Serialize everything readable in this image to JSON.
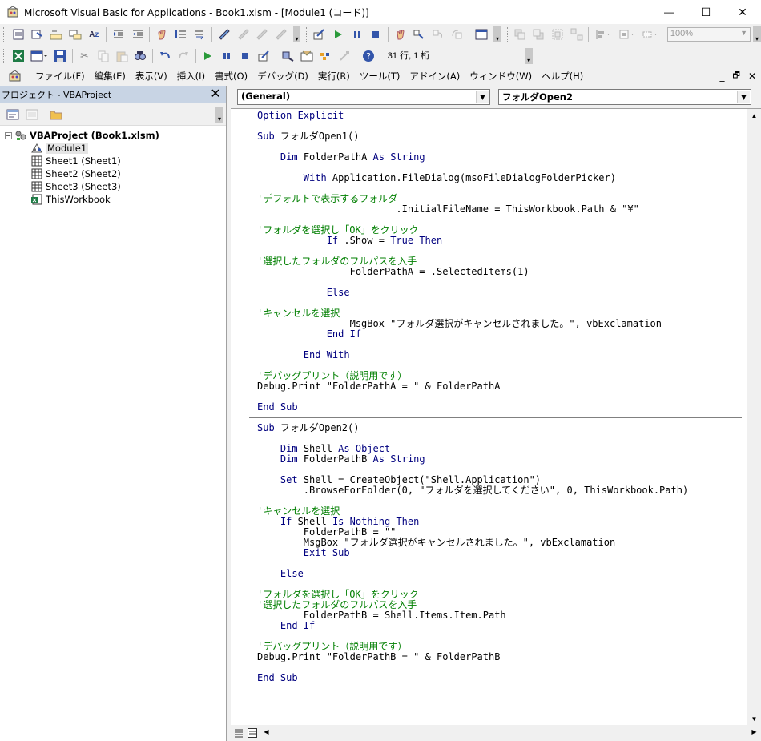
{
  "window": {
    "title": "Microsoft Visual Basic for Applications - Book1.xlsm - [Module1 (コード)]",
    "controls": {
      "minimize": "—",
      "maximize": "☐",
      "close": "✕"
    }
  },
  "toolbar": {
    "zoom": "100%",
    "cursor_position": "31 行, 1 桁"
  },
  "menu": {
    "items": [
      "ファイル(F)",
      "編集(E)",
      "表示(V)",
      "挿入(I)",
      "書式(O)",
      "デバッグ(D)",
      "実行(R)",
      "ツール(T)",
      "アドイン(A)",
      "ウィンドウ(W)",
      "ヘルプ(H)"
    ],
    "mdi_controls": {
      "minimize": "_",
      "restore": "🗗",
      "close": "✕"
    }
  },
  "project_pane": {
    "title": "プロジェクト - VBAProject",
    "close": "✕",
    "root": "VBAProject (Book1.xlsm)",
    "items": [
      "Module1",
      "Sheet1 (Sheet1)",
      "Sheet2 (Sheet2)",
      "Sheet3 (Sheet3)",
      "ThisWorkbook"
    ]
  },
  "code_window": {
    "object_combo": "(General)",
    "procedure_combo": "フォルダOpen2",
    "lines": [
      {
        "t": "Option Explicit",
        "k": "kw"
      },
      {
        "t": "",
        "k": ""
      },
      {
        "t": "Sub フォルダOpen1()",
        "k": "sub"
      },
      {
        "t": "",
        "k": ""
      },
      {
        "t": "    Dim FolderPathA As String",
        "k": "dim"
      },
      {
        "t": "",
        "k": ""
      },
      {
        "t": "        With Application.FileDialog(msoFileDialogFolderPicker)",
        "k": "with"
      },
      {
        "t": "",
        "k": ""
      },
      {
        "t": "'デフォルトで表示するフォルダ",
        "k": "cm"
      },
      {
        "t": "                        .InitialFileName = ThisWorkbook.Path & \"¥\"",
        "k": ""
      },
      {
        "t": "",
        "k": ""
      },
      {
        "t": "'フォルダを選択し「OK」をクリック",
        "k": "cm"
      },
      {
        "t": "            If .Show = True Then",
        "k": "if"
      },
      {
        "t": "",
        "k": ""
      },
      {
        "t": "'選択したフォルダのフルパスを入手",
        "k": "cm"
      },
      {
        "t": "                FolderPathA = .SelectedItems(1)",
        "k": ""
      },
      {
        "t": "",
        "k": ""
      },
      {
        "t": "            Else",
        "k": "kw"
      },
      {
        "t": "",
        "k": ""
      },
      {
        "t": "'キャンセルを選択",
        "k": "cm"
      },
      {
        "t": "                MsgBox \"フォルダ選択がキャンセルされました。\", vbExclamation",
        "k": ""
      },
      {
        "t": "            End If",
        "k": "kw"
      },
      {
        "t": "",
        "k": ""
      },
      {
        "t": "        End With",
        "k": "kw"
      },
      {
        "t": "",
        "k": ""
      },
      {
        "t": "'デバッグプリント（説明用です）",
        "k": "cm"
      },
      {
        "t": "Debug.Print \"FolderPathA = \" & FolderPathA",
        "k": "dbg"
      },
      {
        "t": "",
        "k": ""
      },
      {
        "t": "End Sub",
        "k": "kw"
      },
      {
        "t": "",
        "k": "divider"
      },
      {
        "t": "Sub フォルダOpen2()",
        "k": "sub"
      },
      {
        "t": "",
        "k": ""
      },
      {
        "t": "    Dim Shell As Object",
        "k": "dim"
      },
      {
        "t": "    Dim FolderPathB As String",
        "k": "dim"
      },
      {
        "t": "",
        "k": ""
      },
      {
        "t": "    Set Shell = CreateObject(\"Shell.Application\")",
        "k": "set"
      },
      {
        "t": "        .BrowseForFolder(0, \"フォルダを選択してください\", 0, ThisWorkbook.Path)",
        "k": ""
      },
      {
        "t": "",
        "k": ""
      },
      {
        "t": "'キャンセルを選択",
        "k": "cm"
      },
      {
        "t": "    If Shell Is Nothing Then",
        "k": "ifnothing"
      },
      {
        "t": "        FolderPathB = \"\"",
        "k": ""
      },
      {
        "t": "        MsgBox \"フォルダ選択がキャンセルされました。\", vbExclamation",
        "k": ""
      },
      {
        "t": "        Exit Sub",
        "k": "kw"
      },
      {
        "t": "",
        "k": ""
      },
      {
        "t": "    Else",
        "k": "kw"
      },
      {
        "t": "",
        "k": ""
      },
      {
        "t": "'フォルダを選択し「OK」をクリック",
        "k": "cm"
      },
      {
        "t": "'選択したフォルダのフルパスを入手",
        "k": "cm"
      },
      {
        "t": "        FolderPathB = Shell.Items.Item.Path",
        "k": ""
      },
      {
        "t": "    End If",
        "k": "kw"
      },
      {
        "t": "",
        "k": ""
      },
      {
        "t": "'デバッグプリント（説明用です）",
        "k": "cm"
      },
      {
        "t": "Debug.Print \"FolderPathB = \" & FolderPathB",
        "k": "dbg"
      },
      {
        "t": "",
        "k": ""
      },
      {
        "t": "End Sub",
        "k": "kw"
      }
    ]
  },
  "colors": {
    "keyword": "#00007f",
    "comment": "#007f00",
    "pane_header": "#c8d4e4"
  }
}
